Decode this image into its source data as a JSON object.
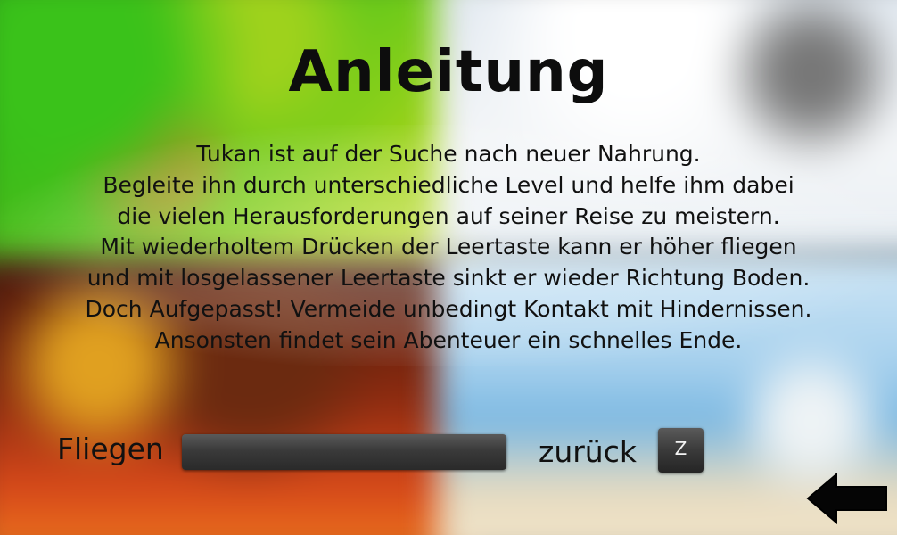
{
  "screen": {
    "title": "Anleitung",
    "instructions": [
      "Tukan ist auf der Suche nach neuer Nahrung.",
      "Begleite ihn durch unterschiedliche Level und helfe ihm dabei",
      "die vielen Herausforderungen auf seiner Reise zu meistern.",
      "Mit wiederholtem Drücken der Leertaste kann er höher fliegen",
      "und mit losgelassener Leertaste sinkt er wieder Richtung Boden.",
      "Doch Aufgepasst! Vermeide unbedingt Kontakt mit Hindernissen.",
      "Ansonsten findet sein Abenteuer ein schnelles Ende."
    ]
  },
  "controls": {
    "fly_label": "Fliegen",
    "back_label": "zurück",
    "back_key": "Z"
  },
  "icons": {
    "back_arrow": "arrow-left-icon"
  },
  "colors": {
    "text": "#111111",
    "key_bg": "#3a3a3a",
    "key_text": "#f2f2f2"
  }
}
